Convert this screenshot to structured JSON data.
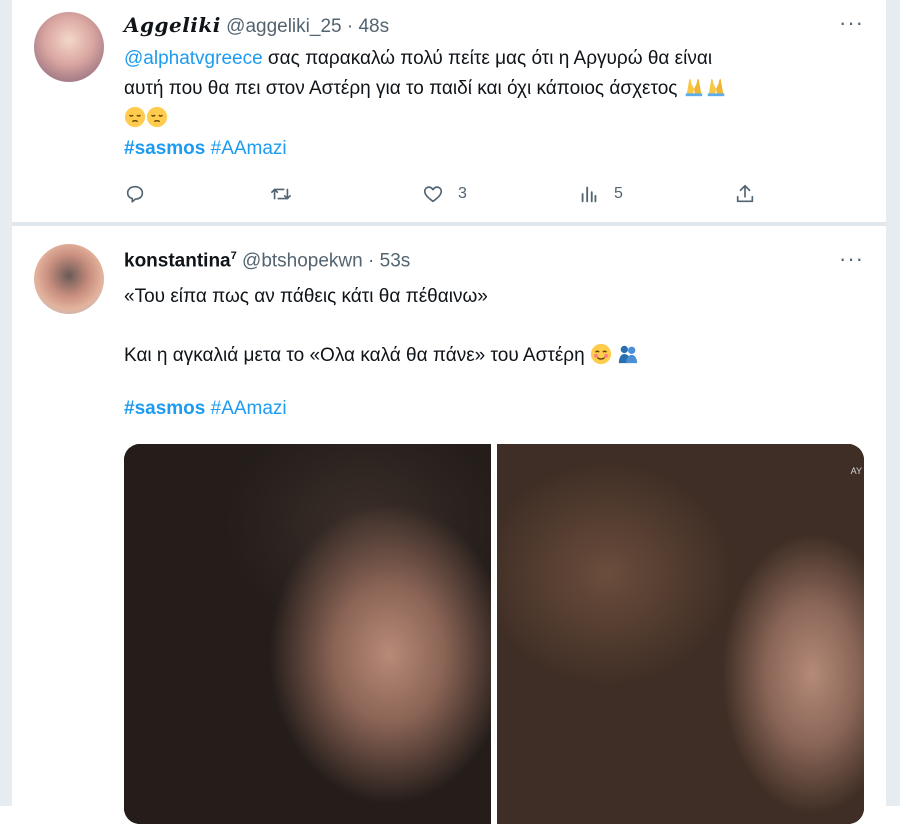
{
  "tweets": [
    {
      "display_name": "Aggeliki",
      "handle": "@aggeliki_25",
      "separator": "·",
      "time": "48s",
      "mention": "@alphatvgreece",
      "text_line1": " σας παρακαλώ πολύ πείτε μας ότι η Αργυρώ θα είναι",
      "text_line2": "αυτή που θα πει στον Αστέρη για το παιδί και όχι κάποιος άσχετος",
      "hashtags": [
        "#sasmos",
        "#AAmazi"
      ],
      "actions": {
        "reply_count": "",
        "retweet_count": "",
        "like_count": "3",
        "views_count": "5"
      }
    },
    {
      "display_name": "konstantina",
      "display_name_sup": "7",
      "handle": "@btshopekwn",
      "separator": "·",
      "time": "53s",
      "line1": "«Του είπα πως αν πάθεις κάτι θα πέθαινω»",
      "line2": "Και η αγκαλιά μετα το «Ολα καλά θα πάνε» του Αστέρη",
      "hashtags": [
        "#sasmos",
        "#AAmazi"
      ],
      "media_watermark": "AY"
    }
  ],
  "more_label": "···",
  "colors": {
    "link": "#1d9bf0",
    "muted": "#536471",
    "text": "#0f1419"
  },
  "icons": [
    "reply-icon",
    "retweet-icon",
    "like-icon",
    "views-icon",
    "share-icon",
    "folded-hands-emoji",
    "pensive-face-emoji",
    "smiling-face-emoji",
    "people-hugging-emoji"
  ]
}
